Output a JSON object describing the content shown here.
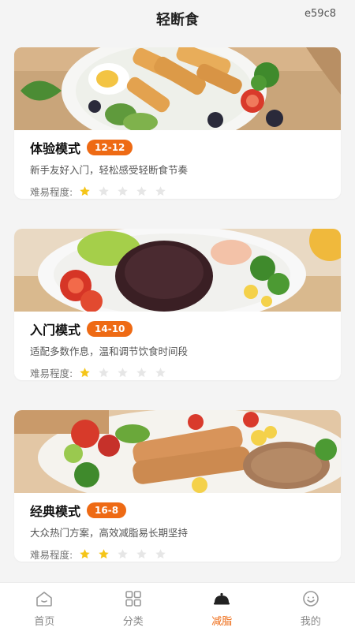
{
  "header": {
    "title": "轻断食",
    "code": "e59c8"
  },
  "modes": [
    {
      "name": "体验模式",
      "badge": "12-12",
      "desc": "新手友好入门，轻松感受轻断食节奏",
      "difficulty_label": "难易程度:",
      "difficulty": 1,
      "difficulty_max": 5
    },
    {
      "name": "入门模式",
      "badge": "14-10",
      "desc": "适配多数作息，温和调节饮食时间段",
      "difficulty_label": "难易程度:",
      "difficulty": 1,
      "difficulty_max": 5
    },
    {
      "name": "经典模式",
      "badge": "16-8",
      "desc": "大众热门方案，高效减脂易长期坚持",
      "difficulty_label": "难易程度:",
      "difficulty": 2,
      "difficulty_max": 5
    }
  ],
  "tabs": [
    {
      "label": "首页",
      "icon": "home-icon"
    },
    {
      "label": "分类",
      "icon": "category-icon"
    },
    {
      "label": "减脂",
      "icon": "dish-cover-icon",
      "active": true
    },
    {
      "label": "我的",
      "icon": "profile-icon"
    }
  ],
  "colors": {
    "accent": "#ee6a14",
    "star_on": "#f5c518",
    "star_off": "#e6e6e6"
  }
}
